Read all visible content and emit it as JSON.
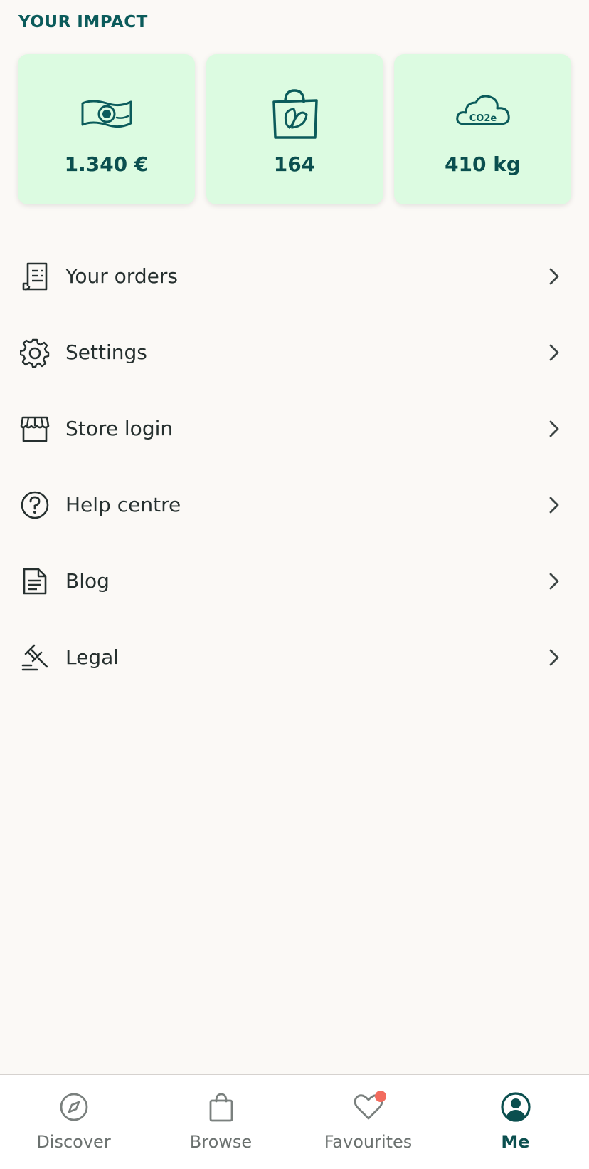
{
  "impact": {
    "title": "YOUR IMPACT",
    "cards": [
      {
        "icon": "money-icon",
        "value": "1.340 €"
      },
      {
        "icon": "bag-icon",
        "value": "164"
      },
      {
        "icon": "co2-cloud-icon",
        "value": "410 kg",
        "icon_text": "CO2e"
      }
    ]
  },
  "menu": {
    "items": [
      {
        "icon": "receipt-icon",
        "label": "Your orders"
      },
      {
        "icon": "gear-icon",
        "label": "Settings"
      },
      {
        "icon": "store-icon",
        "label": "Store login"
      },
      {
        "icon": "help-icon",
        "label": "Help centre"
      },
      {
        "icon": "document-icon",
        "label": "Blog"
      },
      {
        "icon": "gavel-icon",
        "label": "Legal"
      }
    ]
  },
  "tabbar": {
    "active": "Me",
    "tabs": [
      {
        "icon": "compass-icon",
        "label": "Discover"
      },
      {
        "icon": "bag-icon",
        "label": "Browse"
      },
      {
        "icon": "heart-icon",
        "label": "Favourites",
        "badge": true
      },
      {
        "icon": "profile-icon",
        "label": "Me"
      }
    ]
  },
  "colors": {
    "accent": "#0B5B5B",
    "card_bg": "#DCFBE1",
    "page_bg": "#FBF9F6",
    "badge": "#F26B5E"
  }
}
